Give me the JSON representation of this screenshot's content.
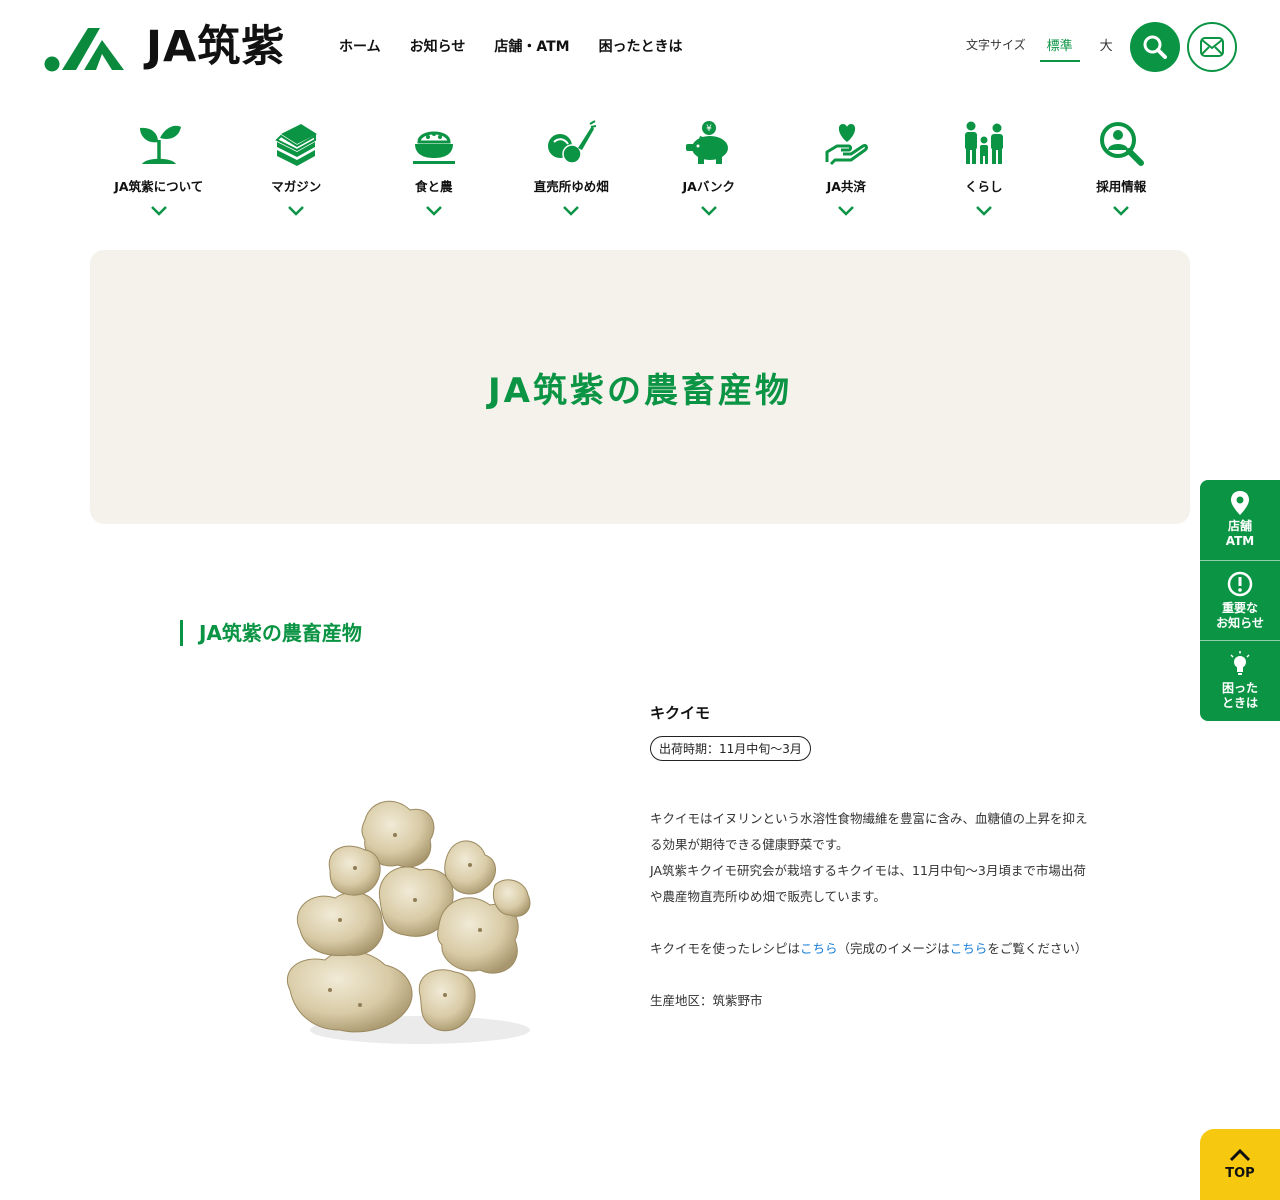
{
  "header": {
    "logo_text": "JA筑紫",
    "nav": [
      "ホーム",
      "お知らせ",
      "店舗・ATM",
      "困ったときは"
    ],
    "fontsize_label": "文字サイズ",
    "fontsize_options": [
      "標準",
      "大"
    ],
    "search_icon": "search-icon",
    "mail_icon": "mail-icon"
  },
  "categories": [
    {
      "label": "JA筑紫について",
      "icon": "sprout-icon"
    },
    {
      "label": "マガジン",
      "icon": "magazine-icon"
    },
    {
      "label": "食と農",
      "icon": "rice-bowl-icon"
    },
    {
      "label": "直売所ゆめ畑",
      "icon": "vegetables-icon"
    },
    {
      "label": "JAバンク",
      "icon": "piggy-bank-icon"
    },
    {
      "label": "JA共済",
      "icon": "hand-heart-icon"
    },
    {
      "label": "くらし",
      "icon": "family-icon"
    },
    {
      "label": "採用情報",
      "icon": "recruit-icon"
    }
  ],
  "hero": {
    "title": "JA筑紫の農畜産物"
  },
  "section": {
    "heading": "JA筑紫の農畜産物"
  },
  "product": {
    "name": "キクイモ",
    "season": "出荷時期：11月中旬〜3月",
    "desc_1": "キクイモはイヌリンという水溶性食物繊維を豊富に含み、血糖値の上昇を抑える効果が期待できる健康野菜です。",
    "desc_2": "JA筑紫キクイモ研究会が栽培するキクイモは、11月中旬〜3月頃まで市場出荷や農産物直売所ゆめ畑で販売しています。",
    "recipe_prefix": "キクイモを使ったレシピは",
    "recipe_link": "こちら",
    "recipe_mid": "（完成のイメージは",
    "recipe_link2": "こちら",
    "recipe_suffix": "をご覧ください）",
    "area": "生産地区：筑紫野市"
  },
  "side_tabs": [
    {
      "label": "店舗\nATM",
      "icon": "location-pin-icon"
    },
    {
      "label": "重要な\nお知らせ",
      "icon": "alert-icon"
    },
    {
      "label": "困った\nときは",
      "icon": "lightbulb-icon"
    }
  ],
  "top_button": {
    "label": "TOP",
    "icon": "chevron-up-icon"
  },
  "colors": {
    "accent": "#0b9444",
    "hero_bg": "#f5f2ec",
    "top_button": "#f6c80f",
    "link": "#1a7fd6"
  }
}
